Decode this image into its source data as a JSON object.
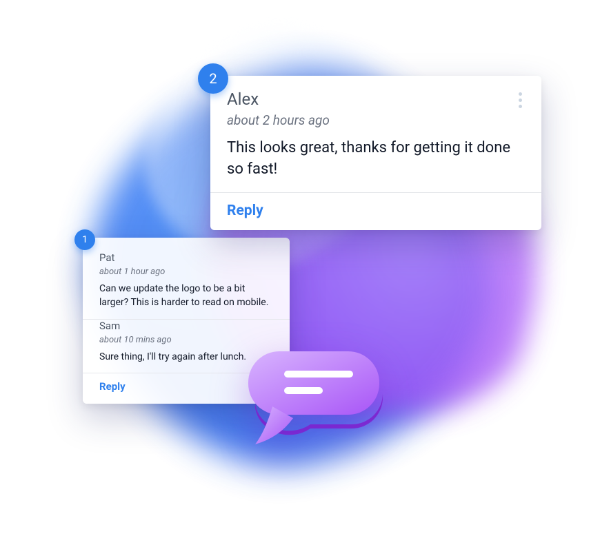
{
  "colors": {
    "badge_bg": "#2f80ed",
    "reply_link": "#2f80ed",
    "author_text": "#4b5563",
    "body_text": "#111827",
    "timestamp_text": "#6b7280"
  },
  "card_large": {
    "badge_number": "2",
    "author": "Alex",
    "timestamp": "about 2 hours ago",
    "body": "This looks great, thanks for getting it done so fast!",
    "reply_label": "Reply"
  },
  "card_small": {
    "badge_number": "1",
    "thread": [
      {
        "author": "Pat",
        "timestamp": "about 1 hour ago",
        "body": "Can we update the logo to be a bit larger? This is harder to read on mobile."
      },
      {
        "author": "Sam",
        "timestamp": "about 10 mins ago",
        "body": "Sure thing, I'll try again after lunch."
      }
    ],
    "reply_label": "Reply"
  }
}
